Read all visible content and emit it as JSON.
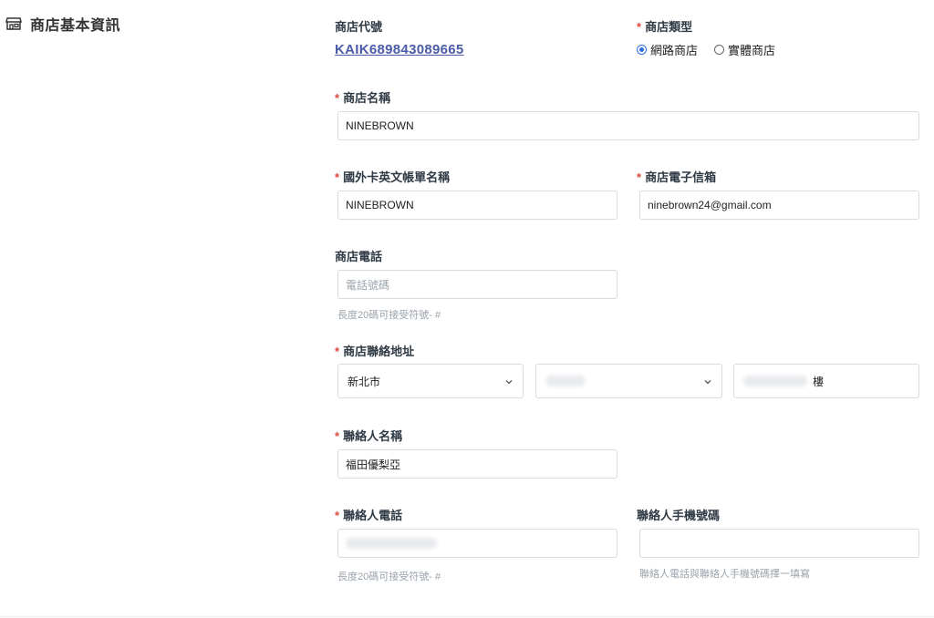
{
  "section": {
    "title": "商店基本資訊",
    "icon": "storefront-icon"
  },
  "fields": {
    "store_code": {
      "label": "商店代號",
      "value": "KAIK689843089665"
    },
    "store_type": {
      "label": "商店類型",
      "options": [
        "網路商店",
        "實體商店"
      ],
      "selected": "網路商店"
    },
    "store_name": {
      "label": "商店名稱",
      "value": "NINEBROWN"
    },
    "card_name_en": {
      "label": "國外卡英文帳單名稱",
      "value": "NINEBROWN"
    },
    "store_email": {
      "label": "商店電子信箱",
      "value": "ninebrown24@gmail.com"
    },
    "store_phone": {
      "label": "商店電話",
      "placeholder": "電話號碼",
      "hint": "長度20碼可接受符號- #"
    },
    "store_address": {
      "label": "商店聯絡地址",
      "city": "新北市",
      "address_suffix": "樓"
    },
    "contact_name": {
      "label": "聯絡人名稱",
      "value": "福田優梨亞"
    },
    "contact_phone": {
      "label": "聯絡人電話",
      "hint": "長度20碼可接受符號- #"
    },
    "contact_mobile": {
      "label": "聯絡人手機號碼",
      "hint": "聯絡人電話與聯絡人手機號碼擇一填寫"
    }
  },
  "colors": {
    "required": "#e0473c",
    "link": "#4a5ba8",
    "radio_accent": "#2b6ee8",
    "border": "#d7dce1"
  }
}
